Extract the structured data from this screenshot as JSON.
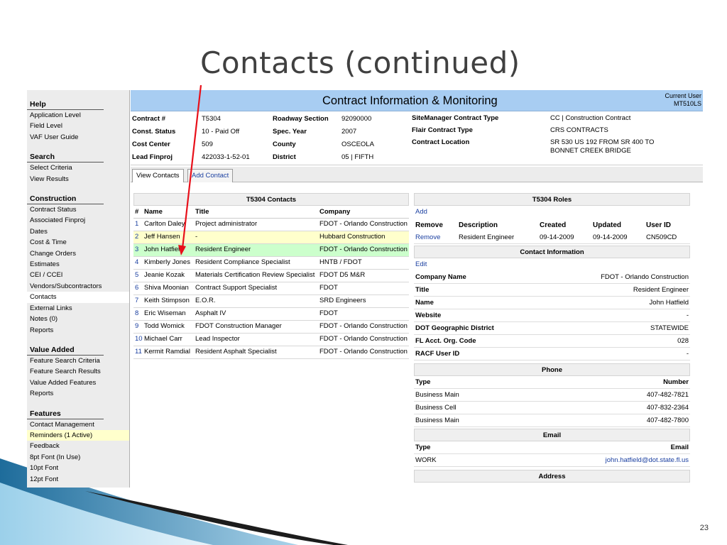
{
  "slide": {
    "title": "Contacts (continued)",
    "page_number": "23"
  },
  "sidebar": {
    "sections": [
      {
        "heading": "Help",
        "items": [
          "Application Level",
          "Field Level",
          "VAF User Guide"
        ]
      },
      {
        "heading": "Search",
        "items": [
          "Select Criteria",
          "View Results"
        ]
      },
      {
        "heading": "Construction",
        "items": [
          "Contract Status",
          "Associated Finproj",
          "Dates",
          "Cost & Time",
          "Change Orders",
          "Estimates",
          "CEI / CCEI",
          "Vendors/Subcontractors",
          "Contacts",
          "External Links",
          "Notes (0)",
          "Reports"
        ]
      },
      {
        "heading": "Value Added",
        "items": [
          "Feature Search Criteria",
          "Feature Search Results",
          "Value Added Features",
          "Reports"
        ]
      },
      {
        "heading": "Features",
        "items": [
          "Contact Management",
          "Reminders (1 Active)",
          "Feedback",
          "8pt Font (In Use)",
          "10pt Font",
          "12pt Font"
        ]
      }
    ]
  },
  "banner": {
    "title": "Contract Information & Monitoring",
    "user_label": "Current User",
    "user_id": "MT510LS"
  },
  "info": {
    "contract_label": "Contract #",
    "contract": "T5304",
    "status_label": "Const. Status",
    "status": "10 - Paid Off",
    "cost_label": "Cost Center",
    "cost": "509",
    "finproj_label": "Lead Finproj",
    "finproj": "422033-1-52-01",
    "roadway_label": "Roadway Section",
    "roadway": "92090000",
    "year_label": "Spec. Year",
    "year": "2007",
    "county_label": "County",
    "county": "OSCEOLA",
    "district_label": "District",
    "district": "05 | FIFTH",
    "smtype_label": "SiteManager Contract Type",
    "smtype": "CC | Construction Contract",
    "flair_label": "Flair Contract Type",
    "flair": "CRS CONTRACTS",
    "location_label": "Contract Location",
    "location1": "SR 530 US 192 FROM SR 400 TO",
    "location2": "BONNET CREEK BRIDGE"
  },
  "tabs": {
    "view": "View Contacts",
    "add": "Add Contact"
  },
  "contacts": {
    "title": "T5304 Contacts",
    "headers": [
      "#",
      "Name",
      "Title",
      "Company"
    ],
    "rows": [
      {
        "num": "1",
        "name": "Carlton Daley",
        "title": "Project administrator",
        "company": "FDOT - Orlando Construction",
        "hl": ""
      },
      {
        "num": "2",
        "name": "Jeff Hansen",
        "title": "-",
        "company": "Hubbard Construction",
        "hl": "yellow"
      },
      {
        "num": "3",
        "name": "John Hatfield",
        "title": "Resident Engineer",
        "company": "FDOT - Orlando Construction",
        "hl": "green"
      },
      {
        "num": "4",
        "name": "Kimberly Jones",
        "title": "Resident Compliance Specialist",
        "company": "HNTB / FDOT",
        "hl": ""
      },
      {
        "num": "5",
        "name": "Jeanie Kozak",
        "title": "Materials Certification Review Specialist",
        "company": "FDOT D5 M&R",
        "hl": ""
      },
      {
        "num": "6",
        "name": "Shiva Moonian",
        "title": "Contract Support Specialist",
        "company": "FDOT",
        "hl": ""
      },
      {
        "num": "7",
        "name": "Keith Stimpson",
        "title": "E.O.R.",
        "company": "SRD Engineers",
        "hl": ""
      },
      {
        "num": "8",
        "name": "Eric Wiseman",
        "title": "Asphalt IV",
        "company": "FDOT",
        "hl": ""
      },
      {
        "num": "9",
        "name": "Todd Womick",
        "title": "FDOT Construction Manager",
        "company": "FDOT - Orlando Construction",
        "hl": ""
      },
      {
        "num": "10",
        "name": "Michael Carr",
        "title": "Lead Inspector",
        "company": "FDOT - Orlando Construction",
        "hl": ""
      },
      {
        "num": "11",
        "name": "Kermit Ramdial",
        "title": "Resident Asphalt Specialist",
        "company": "FDOT - Orlando Construction",
        "hl": ""
      }
    ]
  },
  "roles": {
    "title": "T5304 Roles",
    "add": "Add",
    "headers": [
      "Remove",
      "Description",
      "Created",
      "Updated",
      "User ID"
    ],
    "row": {
      "remove": "Remove",
      "desc": "Resident Engineer",
      "created": "09-14-2009",
      "updated": "09-14-2009",
      "user": "CN509CD"
    }
  },
  "contact_info": {
    "title": "Contact Information",
    "edit": "Edit",
    "fields": [
      {
        "k": "Company Name",
        "v": "FDOT - Orlando Construction"
      },
      {
        "k": "Title",
        "v": "Resident Engineer"
      },
      {
        "k": "Name",
        "v": "John Hatfield"
      },
      {
        "k": "Website",
        "v": "-"
      },
      {
        "k": "DOT Geographic District",
        "v": "STATEWIDE"
      },
      {
        "k": "FL Acct. Org. Code",
        "v": "028"
      },
      {
        "k": "RACF User ID",
        "v": "-"
      }
    ]
  },
  "phone": {
    "title": "Phone",
    "headers": [
      "Type",
      "Number"
    ],
    "rows": [
      {
        "type": "Business Main",
        "number": "407-482-7821"
      },
      {
        "type": "Business Cell",
        "number": "407-832-2364"
      },
      {
        "type": "Business Main",
        "number": "407-482-7800"
      }
    ]
  },
  "email": {
    "title": "Email",
    "headers": [
      "Type",
      "Email"
    ],
    "rows": [
      {
        "type": "WORK",
        "email": "john.hatfield@dot.state.fl.us"
      }
    ]
  },
  "address": {
    "title": "Address"
  },
  "colors": {
    "banner": "#a8cdf2",
    "highlight_yellow": "#ffffcc",
    "highlight_green": "#ccffcc",
    "arrow": "#e8101a",
    "link": "#1a3fa0"
  }
}
